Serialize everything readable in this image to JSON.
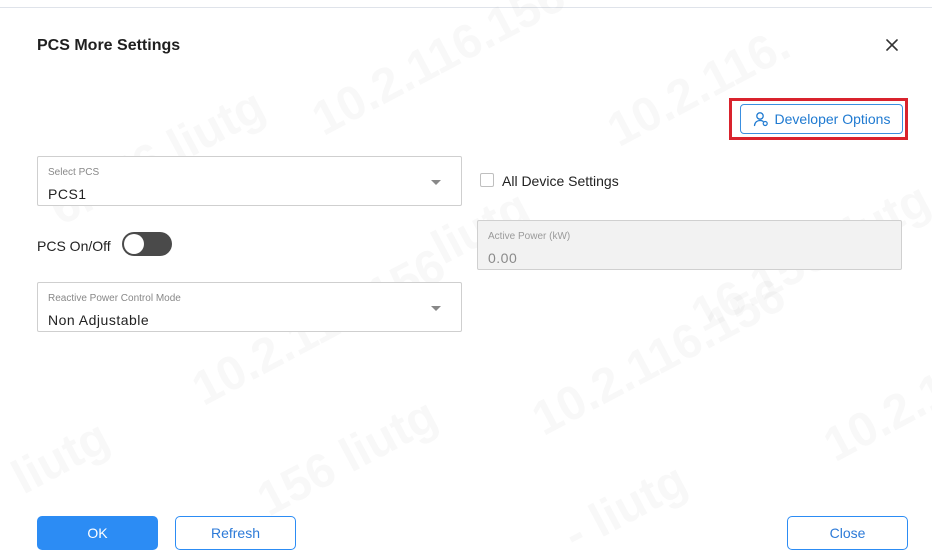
{
  "dialog": {
    "title": "PCS More Settings"
  },
  "developer_options": {
    "label": "Developer Options",
    "icon": "user-settings-icon"
  },
  "select_pcs": {
    "label": "Select PCS",
    "value": "PCS1"
  },
  "all_device_settings": {
    "label": "All Device Settings",
    "checked": false
  },
  "pcs_onoff": {
    "label": "PCS On/Off",
    "state": "off"
  },
  "active_power": {
    "label": "Active Power (kW)",
    "value": "0.00"
  },
  "reactive_mode": {
    "label": "Reactive Power Control Mode",
    "value": "Non Adjustable"
  },
  "footer": {
    "ok": "OK",
    "refresh": "Refresh",
    "close": "Close"
  },
  "colors": {
    "primary": "#2c8cf4",
    "highlight": "#d9232d",
    "toggle_off": "#4a4a4a"
  }
}
